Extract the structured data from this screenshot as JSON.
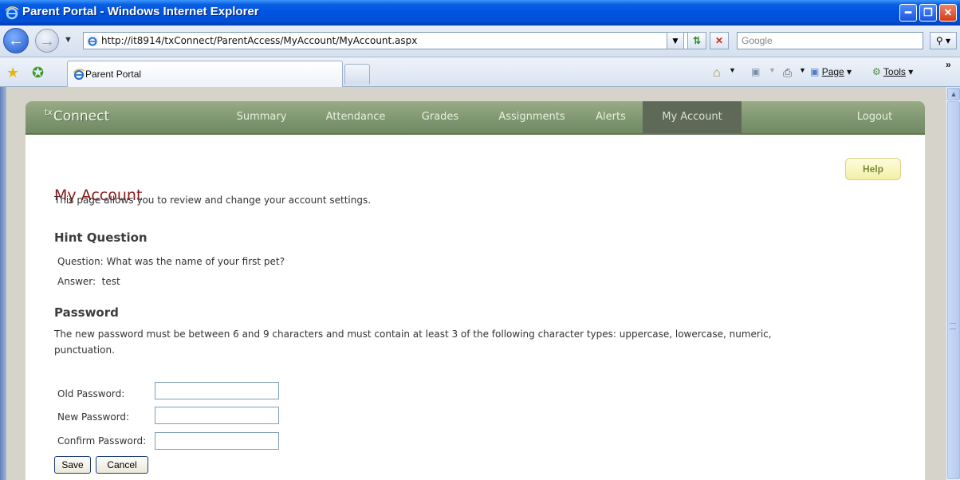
{
  "browser": {
    "window_title": "Parent Portal - Windows Internet Explorer",
    "address": "http://it8914/txConnect/ParentAccess/MyAccount/MyAccount.aspx",
    "search_placeholder": "Google",
    "tab_label": "Parent Portal",
    "commands": {
      "page": "Page",
      "tools": "Tools"
    },
    "colors": {
      "titlebar": "#0054e3"
    }
  },
  "portal": {
    "brand_prefix": "tx",
    "brand": "Connect",
    "nav": [
      "Summary",
      "Attendance",
      "Grades",
      "Assignments",
      "Alerts",
      "My Account",
      "Logout"
    ],
    "selected_nav": "My Account",
    "colors": {
      "nav_bg": "#7d9570",
      "heading": "#8c1818",
      "help_bg": "#f4efa8"
    }
  },
  "page": {
    "title": "My Account",
    "intro": "This page allows you to review and change your account settings.",
    "help_label": "Help",
    "hint": {
      "heading": "Hint Question",
      "question_label": "Question:",
      "question_value": "What was the name of your first pet?",
      "answer_label": "Answer:",
      "answer_value": "test"
    },
    "password": {
      "heading": "Password",
      "rules_line1": "The new password must be between 6 and 9 characters and must contain at least 3 of the following character types: uppercase, lowercase, numeric,",
      "rules_line2": "punctuation.",
      "old_label": "Old Password:",
      "new_label": "New Password:",
      "confirm_label": "Confirm Password:",
      "old_value": "",
      "new_value": "",
      "confirm_value": ""
    },
    "buttons": {
      "save": "Save",
      "cancel": "Cancel"
    }
  }
}
